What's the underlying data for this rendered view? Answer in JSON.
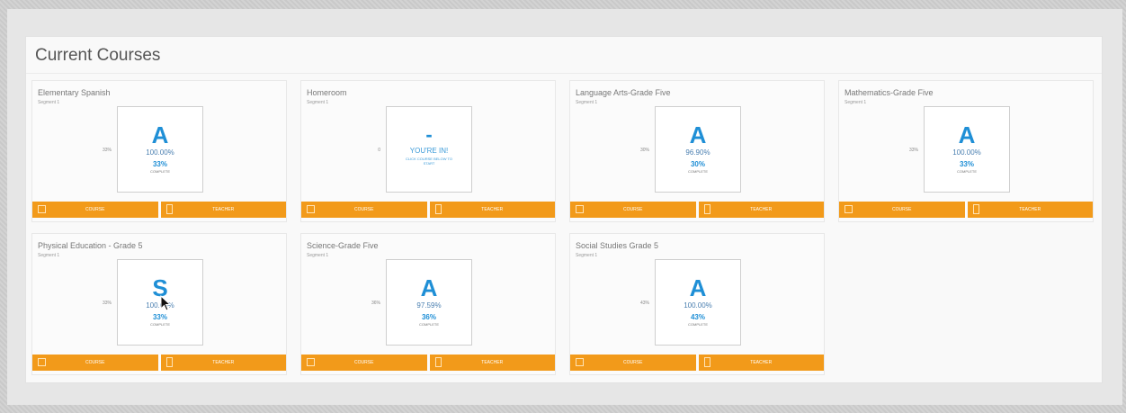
{
  "page": {
    "title": "Current Courses"
  },
  "buttons": {
    "course_label": "COURSE",
    "teacher_label": "TEACHER"
  },
  "courses": [
    {
      "name": "Elementary Spanish",
      "segment": "Segment 1",
      "side_pct": "33%",
      "letter": "A",
      "score": "100.00%",
      "complete_pct": "33%",
      "complete_label": "COMPLETE"
    },
    {
      "name": "Homeroom",
      "segment": "Segment 1",
      "side_pct": "0",
      "letter": "-",
      "status": "YOU'RE IN!",
      "status_sub": "CLICK COURSE BELOW TO START"
    },
    {
      "name": "Language Arts-Grade Five",
      "segment": "Segment 1",
      "side_pct": "30%",
      "letter": "A",
      "score": "96.90%",
      "complete_pct": "30%",
      "complete_label": "COMPLETE"
    },
    {
      "name": "Mathematics-Grade Five",
      "segment": "Segment 1",
      "side_pct": "33%",
      "letter": "A",
      "score": "100.00%",
      "complete_pct": "33%",
      "complete_label": "COMPLETE"
    },
    {
      "name": "Physical Education - Grade 5",
      "segment": "Segment 1",
      "side_pct": "33%",
      "letter": "S",
      "score": "100.00%",
      "complete_pct": "33%",
      "complete_label": "COMPLETE"
    },
    {
      "name": "Science-Grade Five",
      "segment": "Segment 1",
      "side_pct": "36%",
      "letter": "A",
      "score": "97.59%",
      "complete_pct": "36%",
      "complete_label": "COMPLETE"
    },
    {
      "name": "Social Studies Grade 5",
      "segment": "Segment 1",
      "side_pct": "43%",
      "letter": "A",
      "score": "100.00%",
      "complete_pct": "43%",
      "complete_label": "COMPLETE"
    }
  ],
  "colors": {
    "accent": "#f29a1a",
    "grade_blue": "#1f8fd6"
  },
  "icons": {
    "course": "gradebook-icon",
    "teacher": "phone-icon",
    "cursor": "mouse-cursor-icon"
  }
}
